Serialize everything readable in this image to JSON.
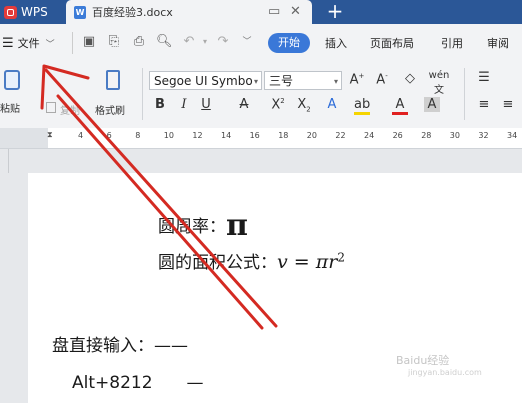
{
  "tabs": {
    "app_label": "WPS",
    "doc_title": "百度经验3.docx",
    "new_tab": "+"
  },
  "menu": {
    "file_label": "文件",
    "start_label": "开始",
    "insert_label": "插入",
    "layout_label": "页面布局",
    "reference_label": "引用",
    "review_label": "审阅"
  },
  "ribbon": {
    "paste_label": "粘贴",
    "copy_label": "复制",
    "format_painter_label": "格式刷",
    "font_name": "Segoe UI Symbo",
    "font_size": "三号",
    "wen_label": "wén 文"
  },
  "ruler": {
    "ticks": [
      "4",
      "6",
      "8",
      "10",
      "12",
      "14",
      "16",
      "18",
      "20",
      "22",
      "24",
      "26",
      "28",
      "30",
      "32",
      "34"
    ]
  },
  "document": {
    "line1_text": "圆周率：",
    "line1_symbol": "π",
    "line2_text": "圆的面积公式：",
    "line2_formula": "v = πr",
    "line2_exp": "2",
    "line3_text": "盘直接输入：——",
    "line4_code": "Alt+8212",
    "line4_dash": "—"
  },
  "watermark": {
    "brand": "Baidu经验",
    "url": "jingyan.baidu.com"
  },
  "colors": {
    "titlebar": "#2b5797",
    "accent": "#3a78d8",
    "arrow": "#d42a22"
  }
}
